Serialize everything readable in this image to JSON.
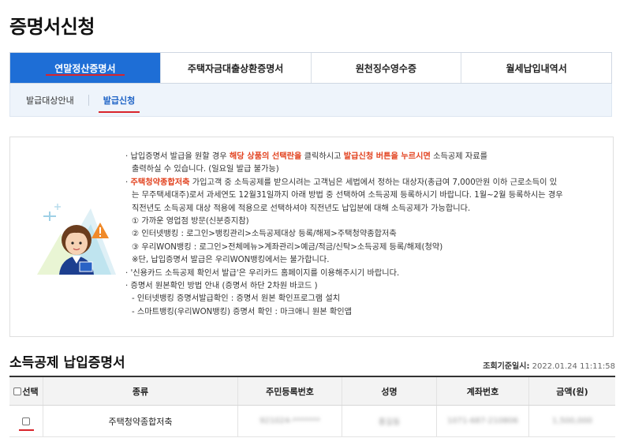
{
  "page": {
    "title": "증명서신청"
  },
  "main_tabs": [
    {
      "label": "연말정산증명서"
    },
    {
      "label": "주택자금대출상환증명서"
    },
    {
      "label": "원천징수영수증"
    },
    {
      "label": "월세납입내역서"
    }
  ],
  "sub_tabs": [
    {
      "label": "발급대상안내"
    },
    {
      "label": "발급신청"
    }
  ],
  "notice": {
    "l1a": "· 납입증명서 발급을 원할 경우 ",
    "l1b": "해당 상품의 선택란을",
    "l1c": " 클릭하시고 ",
    "l1d": "발급신청 버튼을 누르시면",
    "l1e": " 소득공제 자료를",
    "l2": "출력하실 수 있습니다. (일요일 발급 불가능)",
    "l3a": "· ",
    "l3b": "주택청약종합저축",
    "l3c": " 가입고객 중 소득공제를 받으시려는 고객님은 세법에서 정하는 대상자(총급여 7,000만원 이하 근로소득이 있",
    "l4": "는 무주택세대주)로서 과세연도 12월31일까지 아래 방법 중 선택하여 소득공제 등록하시기 바랍니다. 1월~2월 등록하시는 경우",
    "l5": "직전년도 소득공제 대상 적용에 적용으로 선택하셔야 직전년도 납입분에 대해 소득공제가 가능합니다.",
    "l6": "① 가까운 영업점 방문(신분증지참)",
    "l7": "② 인터넷뱅킹 : 로그인>뱅킹관리>소득공제대상 등록/해제>주택청약종합저축",
    "l8": "③ 우리WON뱅킹 : 로그인>전체메뉴>계좌관리>예금/적금/신탁>소득공제 등록/해제(청약)",
    "l9": "※단, 납입증명서 발급은 우리WON뱅킹에서는 불가합니다.",
    "l10": "· '신용카드 소득공제 확인서 발급'은 우리카드 홈페이지를 이용해주시기 바랍니다.",
    "l11": "· 증명서 원본확인 방법 안내 (증명서 하단 2차원 바코드 )",
    "l12": "- 인터넷뱅킹 증명서발급확인 : 증명서 원본 확인프로그램 설치",
    "l13": "- 스마트뱅킹(우리WON뱅킹) 증명서 확인 : 마크애니 원본 확인앱"
  },
  "section": {
    "title": "소득공제 납입증명서",
    "base_date_label": "조회기준일시:",
    "base_date_value": "2022.01.24 11:11:58"
  },
  "table": {
    "headers": [
      "선택",
      "종류",
      "주민등록번호",
      "성명",
      "계좌번호",
      "금액(원)"
    ],
    "rows": [
      {
        "type": "주택청약종합저축",
        "rrn": "921024-*******",
        "name": "홍길동",
        "account": "1071-687-210806",
        "amount": "1,500,000"
      }
    ]
  },
  "colors": {
    "accent": "#1e6ed6",
    "highlight": "#e2421f",
    "underline": "#d9242b"
  }
}
